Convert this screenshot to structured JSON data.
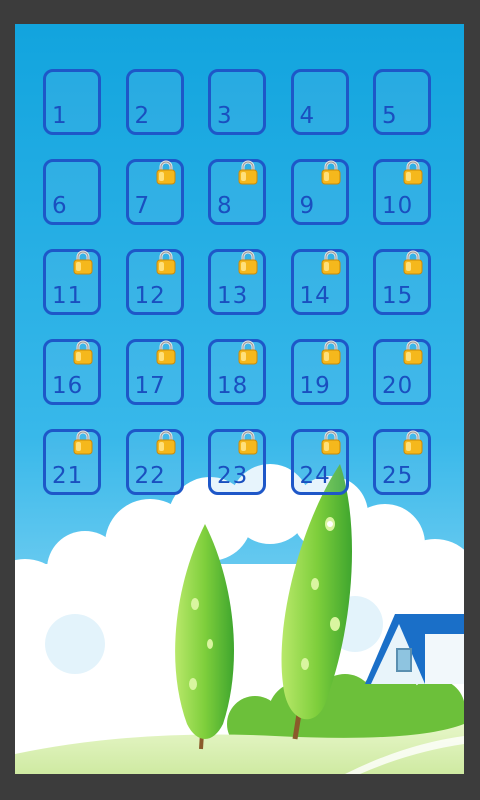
{
  "colors": {
    "sky_top": "#12a4de",
    "sky_bottom": "#aee4f8",
    "tile_border": "#1e57c8",
    "tile_number": "#1a4fbf",
    "lock_gold": "#f5b81c",
    "lock_shackle": "#e6e6e6",
    "frame": "#3c3c3c"
  },
  "levels": [
    {
      "number": "1",
      "locked": false
    },
    {
      "number": "2",
      "locked": false
    },
    {
      "number": "3",
      "locked": false
    },
    {
      "number": "4",
      "locked": false
    },
    {
      "number": "5",
      "locked": false
    },
    {
      "number": "6",
      "locked": false
    },
    {
      "number": "7",
      "locked": true
    },
    {
      "number": "8",
      "locked": true
    },
    {
      "number": "9",
      "locked": true
    },
    {
      "number": "10",
      "locked": true
    },
    {
      "number": "11",
      "locked": true
    },
    {
      "number": "12",
      "locked": true
    },
    {
      "number": "13",
      "locked": true
    },
    {
      "number": "14",
      "locked": true
    },
    {
      "number": "15",
      "locked": true
    },
    {
      "number": "16",
      "locked": true
    },
    {
      "number": "17",
      "locked": true
    },
    {
      "number": "18",
      "locked": true
    },
    {
      "number": "19",
      "locked": true
    },
    {
      "number": "20",
      "locked": true
    },
    {
      "number": "21",
      "locked": true
    },
    {
      "number": "22",
      "locked": true
    },
    {
      "number": "23",
      "locked": true
    },
    {
      "number": "24",
      "locked": true
    },
    {
      "number": "25",
      "locked": true
    }
  ],
  "icons": {
    "lock": "padlock-icon"
  }
}
